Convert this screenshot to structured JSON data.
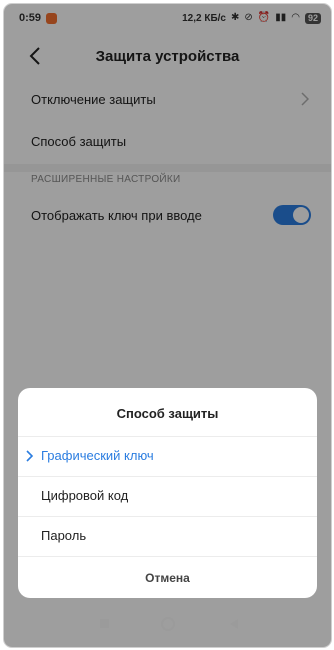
{
  "status_bar": {
    "time": "0:59",
    "network_speed": "12,2 КБ/с",
    "battery": "92"
  },
  "header": {
    "title": "Защита устройства"
  },
  "settings": {
    "disable_protection": "Отключение защиты",
    "protection_method": "Способ защиты",
    "advanced_section": "РАСШИРЕННЫЕ НАСТРОЙКИ",
    "show_key_label": "Отображать ключ при вводе",
    "show_key_enabled": true
  },
  "dialog": {
    "title": "Способ защиты",
    "options": [
      {
        "label": "Графический ключ",
        "selected": true
      },
      {
        "label": "Цифровой код",
        "selected": false
      },
      {
        "label": "Пароль",
        "selected": false
      }
    ],
    "cancel_label": "Отмена"
  },
  "colors": {
    "accent": "#2b7de0",
    "notification": "#f4702f"
  },
  "icons": {
    "back": "back-arrow-icon",
    "chevron": "chevron-right-icon",
    "check": "check-icon",
    "nav_recent": "square-icon",
    "nav_home": "circle-icon",
    "nav_back": "triangle-back-icon"
  }
}
